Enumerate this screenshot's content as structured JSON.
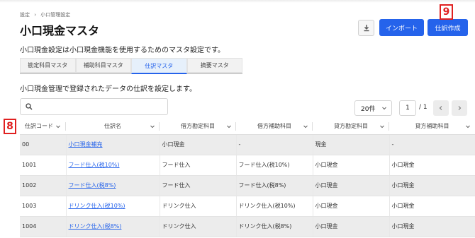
{
  "breadcrumb": [
    "設定",
    "›",
    "小口管理設定"
  ],
  "title": "小口現金マスタ",
  "buttons": {
    "import": "インポート",
    "create": "仕訳作成"
  },
  "callouts": {
    "c9": "9",
    "c8": "8"
  },
  "description": "小口現金設定は小口現金機能を使用するためのマスタ設定です。",
  "tabs": [
    "勘定科目マスタ",
    "補助科目マスタ",
    "仕訳マスタ",
    "摘要マスタ"
  ],
  "active_tab": 2,
  "section_description": "小口現金管理で登録されたデータの仕訳を設定します。",
  "search": {
    "placeholder": ""
  },
  "pagination": {
    "per_page": "20件",
    "current_page": "1",
    "total": "/ 1"
  },
  "table": {
    "columns": [
      "仕訳コード",
      "仕訳名",
      "借方勘定科目",
      "借方補助科目",
      "貸方勘定科目",
      "貸方補助科目"
    ],
    "rows": [
      [
        "00",
        "小口現金補充",
        "小口現金",
        "-",
        "現金",
        "-"
      ],
      [
        "1001",
        "フード仕入(税10%)",
        "フード仕入",
        "フード仕入(税10%)",
        "小口現金",
        "小口現金"
      ],
      [
        "1002",
        "フード仕入(税8%)",
        "フード仕入",
        "フード仕入(税8%)",
        "小口現金",
        "小口現金"
      ],
      [
        "1003",
        "ドリンク仕入(税10%)",
        "ドリンク仕入",
        "ドリンク仕入(税10%)",
        "小口現金",
        "小口現金"
      ],
      [
        "1004",
        "ドリンク仕入(税8%)",
        "ドリンク仕入",
        "ドリンク仕入(税8%)",
        "小口現金",
        "小口現金"
      ]
    ]
  },
  "colors": {
    "accent": "#2563eb",
    "callout": "#e02020"
  },
  "icons": {
    "download": "download-icon",
    "search": "search-icon",
    "chevron": "chevron-down-icon"
  }
}
